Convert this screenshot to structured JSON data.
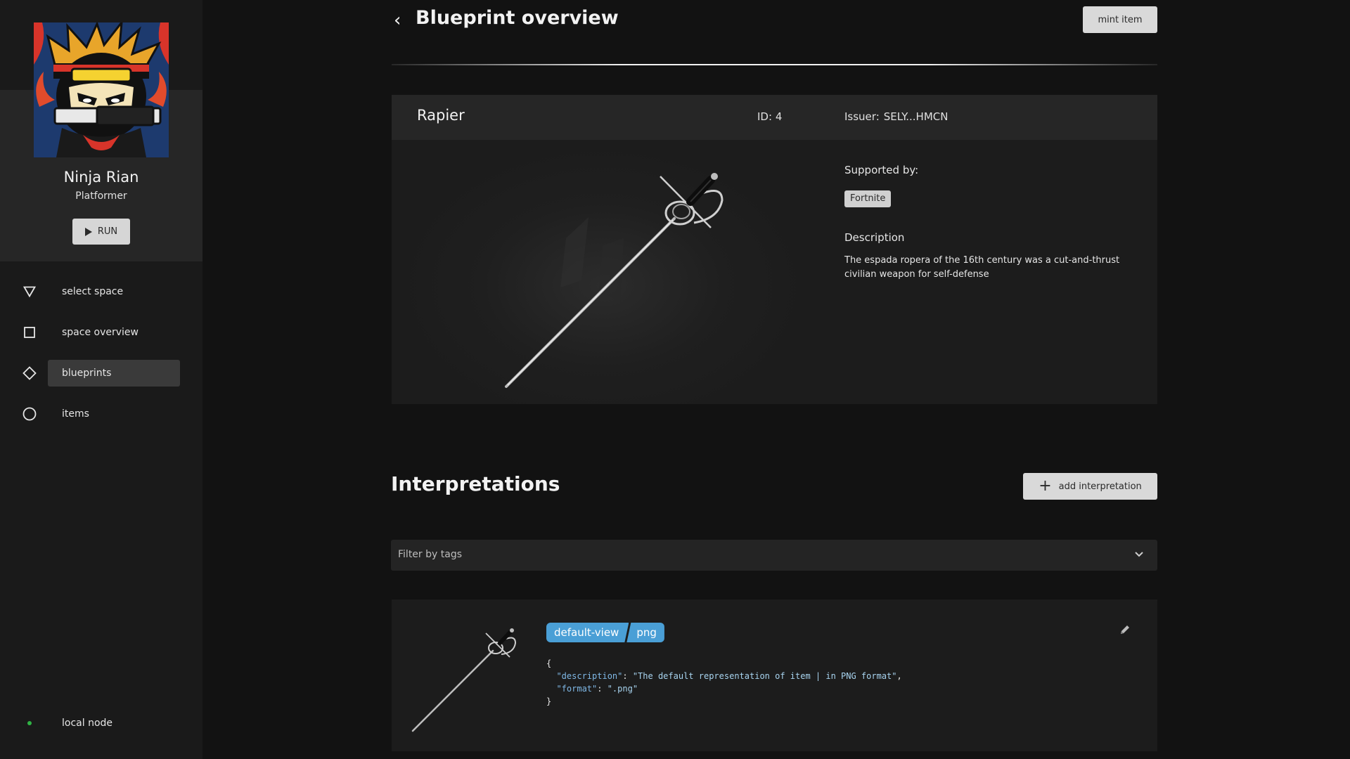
{
  "game": {
    "name": "Ninja Rian",
    "genre": "Platformer",
    "run_label": "RUN"
  },
  "nav": {
    "items": [
      {
        "label": "select space",
        "icon": "triangle-down-icon"
      },
      {
        "label": "space overview",
        "icon": "square-icon"
      },
      {
        "label": "blueprints",
        "icon": "diamond-icon",
        "active": true
      },
      {
        "label": "items",
        "icon": "circle-icon"
      }
    ],
    "node_label": "local node",
    "node_status_color": "#2fb344"
  },
  "header": {
    "title": "Blueprint overview",
    "mint_label": "mint item"
  },
  "blueprint": {
    "name": "Rapier",
    "id_label": "ID:",
    "id_value": "4",
    "issuer_label": "Issuer:",
    "issuer_value": "SELY...HMCN",
    "supported_label": "Supported by:",
    "supported_tags": [
      "Fortnite"
    ],
    "description_label": "Description",
    "description": "The espada ropera of the 16th century was a cut-and-thrust civilian weapon for self-defense"
  },
  "interpretations": {
    "title": "Interpretations",
    "add_label": "add interpretation",
    "filter_placeholder": "Filter by tags",
    "cards": [
      {
        "tags": [
          "default-view",
          "png"
        ],
        "json_line_open": "{",
        "json_key1": "\"description\"",
        "json_val1": "\"The default representation of item | in PNG format\"",
        "json_key2": "\"format\"",
        "json_val2": "\".png\"",
        "json_line_close": "}"
      }
    ]
  },
  "colors": {
    "background": "#121212",
    "sidebar": "#1a1a1a",
    "tag_accent": "#4a9fd6",
    "button": "#d9d9d9"
  }
}
